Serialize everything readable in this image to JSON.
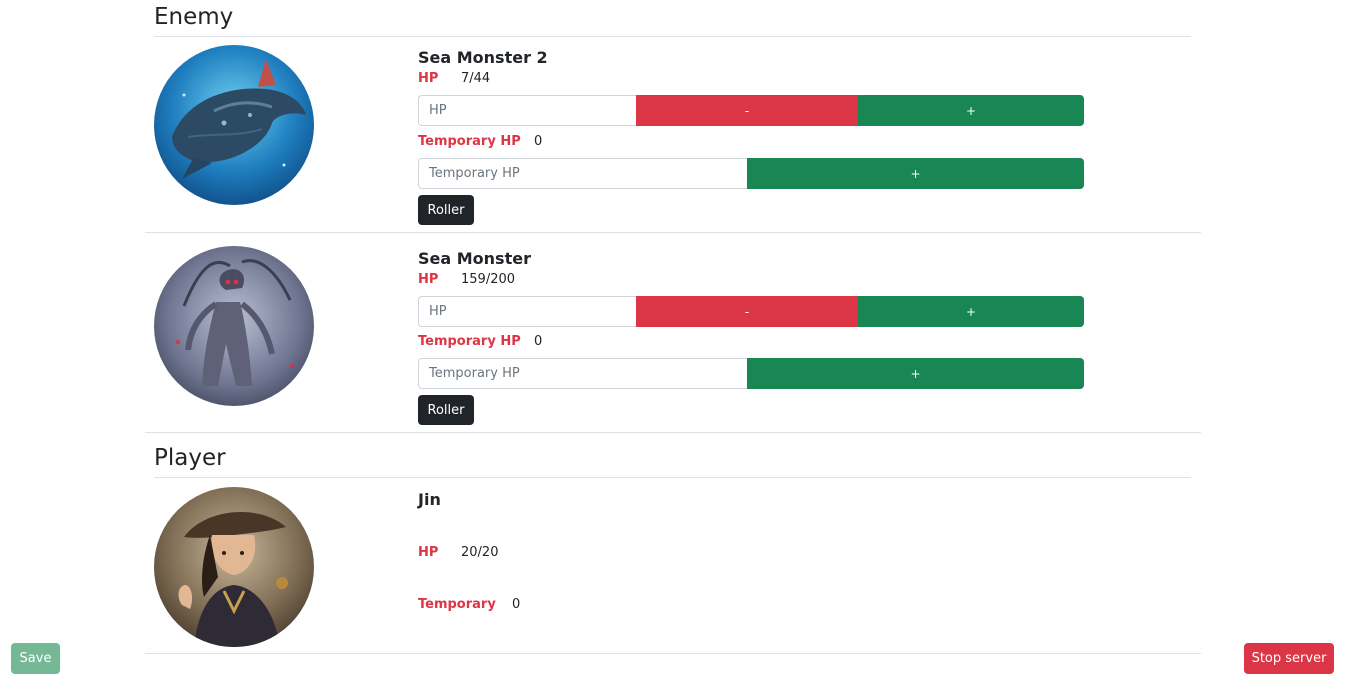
{
  "sections": {
    "enemy_title": "Enemy",
    "player_title": "Player"
  },
  "enemies": [
    {
      "name": "Sea Monster 2",
      "hp_label": "HP",
      "hp_value": "7/44",
      "hp_placeholder": "HP",
      "minus_label": "-",
      "plus_label": "+",
      "temp_label": "Temporary HP",
      "temp_value": "0",
      "temp_placeholder": "Temporary HP",
      "temp_plus_label": "+",
      "roller_label": "Roller"
    },
    {
      "name": "Sea Monster",
      "hp_label": "HP",
      "hp_value": "159/200",
      "hp_placeholder": "HP",
      "minus_label": "-",
      "plus_label": "+",
      "temp_label": "Temporary HP",
      "temp_value": "0",
      "temp_placeholder": "Temporary HP",
      "temp_plus_label": "+",
      "roller_label": "Roller"
    }
  ],
  "player": {
    "name": "Jin",
    "hp_label": "HP",
    "hp_value": "20/20",
    "temp_label": "Temporary",
    "temp_value": "0"
  },
  "footer": {
    "save_label": "Save",
    "stop_label": "Stop server"
  },
  "colors": {
    "danger": "#dc3545",
    "success": "#198754",
    "dark": "#212529",
    "save_faded": "#74b896"
  }
}
